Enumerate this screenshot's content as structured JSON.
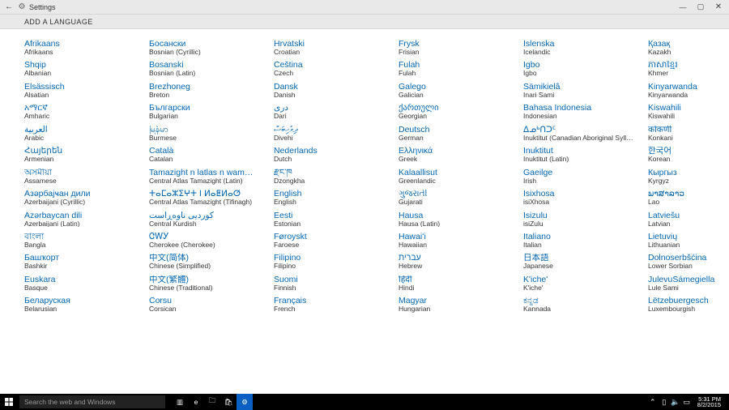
{
  "window": {
    "title": "Settings",
    "back_glyph": "←",
    "gear_glyph": "⚙",
    "min_glyph": "—",
    "max_glyph": "▢",
    "close_glyph": "✕"
  },
  "subheader": {
    "label": "ADD A LANGUAGE"
  },
  "columns": [
    [
      {
        "native": "Afrikaans",
        "english": "Afrikaans"
      },
      {
        "native": "Shqip",
        "english": "Albanian"
      },
      {
        "native": "Elsässisch",
        "english": "Alsatian"
      },
      {
        "native": "አማርኛ",
        "english": "Amharic"
      },
      {
        "native": "العربية",
        "english": "Arabic"
      },
      {
        "native": "Հայերեն",
        "english": "Armenian"
      },
      {
        "native": "অসমীয়া",
        "english": "Assamese"
      },
      {
        "native": "Азәрбајҹан дили",
        "english": "Azerbaijani (Cyrillic)"
      },
      {
        "native": "Azərbaycan dili",
        "english": "Azerbaijani (Latin)"
      },
      {
        "native": "বাংলা",
        "english": "Bangla"
      },
      {
        "native": "Башҡорт",
        "english": "Bashkir"
      },
      {
        "native": "Euskara",
        "english": "Basque"
      },
      {
        "native": "Беларуская",
        "english": "Belarusian"
      }
    ],
    [
      {
        "native": "Босански",
        "english": "Bosnian (Cyrillic)"
      },
      {
        "native": "Bosanski",
        "english": "Bosnian (Latin)"
      },
      {
        "native": "Brezhoneg",
        "english": "Breton"
      },
      {
        "native": "Български",
        "english": "Bulgarian"
      },
      {
        "native": "မြန်မာ",
        "english": "Burmese"
      },
      {
        "native": "Català",
        "english": "Catalan"
      },
      {
        "native": "Tamazight n latlas n wamm…",
        "english": "Central Atlas Tamazight (Latin)"
      },
      {
        "native": "ⵜⴰⵎⴰⵣⵉⵖⵜ ⵏ ⵍⴰⵟⵍⴰⵚ",
        "english": "Central Atlas Tamazight (Tifinagh)"
      },
      {
        "native": "کوردیی ناوەڕاست",
        "english": "Central Kurdish"
      },
      {
        "native": "ᏣᎳᎩ",
        "english": "Cherokee (Cherokee)"
      },
      {
        "native": "中文(简体)",
        "english": "Chinese (Simplified)"
      },
      {
        "native": "中文(繁體)",
        "english": "Chinese (Traditional)"
      },
      {
        "native": "Corsu",
        "english": "Corsican"
      }
    ],
    [
      {
        "native": "Hrvatski",
        "english": "Croatian"
      },
      {
        "native": "Čeština",
        "english": "Czech"
      },
      {
        "native": "Dansk",
        "english": "Danish"
      },
      {
        "native": "درى",
        "english": "Dari"
      },
      {
        "native": "ދިވެހިބަސް",
        "english": "Divehi"
      },
      {
        "native": "Nederlands",
        "english": "Dutch"
      },
      {
        "native": "རྫོང་ཁ",
        "english": "Dzongkha"
      },
      {
        "native": "English",
        "english": "English"
      },
      {
        "native": "Eesti",
        "english": "Estonian"
      },
      {
        "native": "Føroyskt",
        "english": "Faroese"
      },
      {
        "native": "Filipino",
        "english": "Filipino"
      },
      {
        "native": "Suomi",
        "english": "Finnish"
      },
      {
        "native": "Français",
        "english": "French"
      }
    ],
    [
      {
        "native": "Frysk",
        "english": "Frisian"
      },
      {
        "native": "Fulah",
        "english": "Fulah"
      },
      {
        "native": "Galego",
        "english": "Galician"
      },
      {
        "native": "ქართული",
        "english": "Georgian"
      },
      {
        "native": "Deutsch",
        "english": "German"
      },
      {
        "native": "Ελληνικά",
        "english": "Greek"
      },
      {
        "native": "Kalaallisut",
        "english": "Greenlandic"
      },
      {
        "native": "ગુજરાતી",
        "english": "Gujarati"
      },
      {
        "native": "Hausa",
        "english": "Hausa (Latin)"
      },
      {
        "native": "Hawaiʻi",
        "english": "Hawaiian"
      },
      {
        "native": "עברית",
        "english": "Hebrew"
      },
      {
        "native": "हिंदी",
        "english": "Hindi"
      },
      {
        "native": "Magyar",
        "english": "Hungarian"
      }
    ],
    [
      {
        "native": "Íslenska",
        "english": "Icelandic"
      },
      {
        "native": "Igbo",
        "english": "Igbo"
      },
      {
        "native": "Sämikielâ",
        "english": "Inari Sami"
      },
      {
        "native": "Bahasa Indonesia",
        "english": "Indonesian"
      },
      {
        "native": "ᐃᓄᒃᑎᑐᑦ",
        "english": "Inuktitut (Canadian Aboriginal Syllabics)"
      },
      {
        "native": "Inuktitut",
        "english": "Inuktitut (Latin)"
      },
      {
        "native": "Gaeilge",
        "english": "Irish"
      },
      {
        "native": "Isixhosa",
        "english": "isiXhosa"
      },
      {
        "native": "Isizulu",
        "english": "isiZulu"
      },
      {
        "native": "Italiano",
        "english": "Italian"
      },
      {
        "native": "日本語",
        "english": "Japanese"
      },
      {
        "native": "K'iche'",
        "english": "K'iche'"
      },
      {
        "native": "ಕನ್ನಡ",
        "english": "Kannada"
      }
    ],
    [
      {
        "native": "Қазақ",
        "english": "Kazakh"
      },
      {
        "native": "ភាសាខ្មែរ",
        "english": "Khmer"
      },
      {
        "native": "Kinyarwanda",
        "english": "Kinyarwanda"
      },
      {
        "native": "Kiswahili",
        "english": "Kiswahili"
      },
      {
        "native": "कोंकणी",
        "english": "Konkani"
      },
      {
        "native": "한국어",
        "english": "Korean"
      },
      {
        "native": "Кыргыз",
        "english": "Kyrgyz"
      },
      {
        "native": "ພາສາລາວ",
        "english": "Lao"
      },
      {
        "native": "Latviešu",
        "english": "Latvian"
      },
      {
        "native": "Lietuvių",
        "english": "Lithuanian"
      },
      {
        "native": "Dolnoserbšćina",
        "english": "Lower Sorbian"
      },
      {
        "native": "JulevuSámegiella",
        "english": "Lule Sami"
      },
      {
        "native": "Lëtzebuergesch",
        "english": "Luxembourgish"
      }
    ]
  ],
  "taskbar": {
    "search_placeholder": "Search the web and Windows",
    "time": "5:31 PM",
    "date": "8/2/2015",
    "tray_up": "⌃",
    "tray_sound": "🔈",
    "tray_net": "▯",
    "tray_action": "▭"
  }
}
